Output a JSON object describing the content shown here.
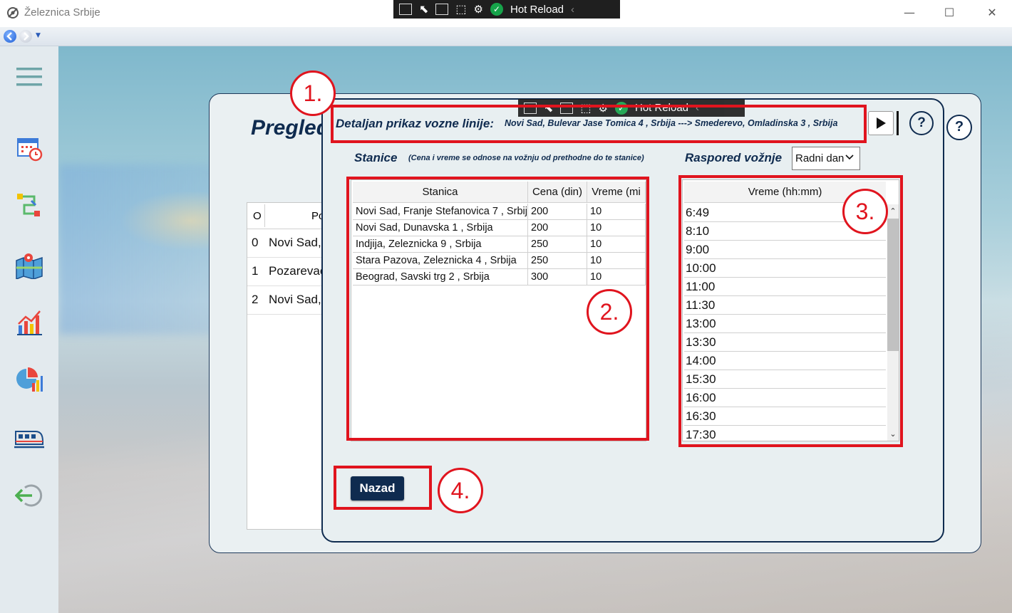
{
  "window": {
    "title": "Železnica Srbije",
    "minimize": "—",
    "maximize": "☐",
    "close": "✕"
  },
  "hot_reload": {
    "label": "Hot Reload"
  },
  "back_window": {
    "title": "Pregled",
    "table_headers": [
      "O",
      "Po"
    ],
    "rows": [
      {
        "idx": "0",
        "text": "Novi Sad,"
      },
      {
        "idx": "1",
        "text": "Pozarevac"
      },
      {
        "idx": "2",
        "text": "Novi Sad,"
      }
    ],
    "help": "?"
  },
  "dialog": {
    "label": "Detaljan prikaz vozne linije:",
    "route": "Novi Sad, Bulevar Jase Tomica 4 , Srbija  ---> Smederevo, Omladinska 3 , Srbija",
    "help": "?",
    "stations_title": "Stanice",
    "stations_note": "(Cena i vreme se odnose na vožnju od prethodne do te stanice)",
    "schedule_title": "Raspored vožnje",
    "day_select": "Radni dan",
    "back_button": "Nazad",
    "stations_table": {
      "headers": [
        "Stanica",
        "Cena (din)",
        "Vreme (mi"
      ],
      "rows": [
        [
          "Novi Sad, Franje Stefanovica 7 , Srbija",
          "200",
          "10"
        ],
        [
          "Novi Sad, Dunavska 1 , Srbija",
          "200",
          "10"
        ],
        [
          "Indjija, Zeleznicka 9 , Srbija",
          "250",
          "10"
        ],
        [
          "Stara Pazova, Zeleznicka 4 , Srbija",
          "250",
          "10"
        ],
        [
          "Beograd, Savski trg 2 , Srbija",
          "300",
          "10"
        ]
      ]
    },
    "times_table": {
      "header": "Vreme (hh:mm)",
      "rows": [
        "6:49",
        "8:10",
        "9:00",
        "10:00",
        "11:00",
        "11:30",
        "13:00",
        "13:30",
        "14:00",
        "15:30",
        "16:00",
        "16:30",
        "17:30"
      ]
    }
  },
  "annotations": [
    "1.",
    "2.",
    "3.",
    "4."
  ],
  "colors": {
    "accent": "#0f2b4f",
    "annotation": "#e0141e"
  }
}
